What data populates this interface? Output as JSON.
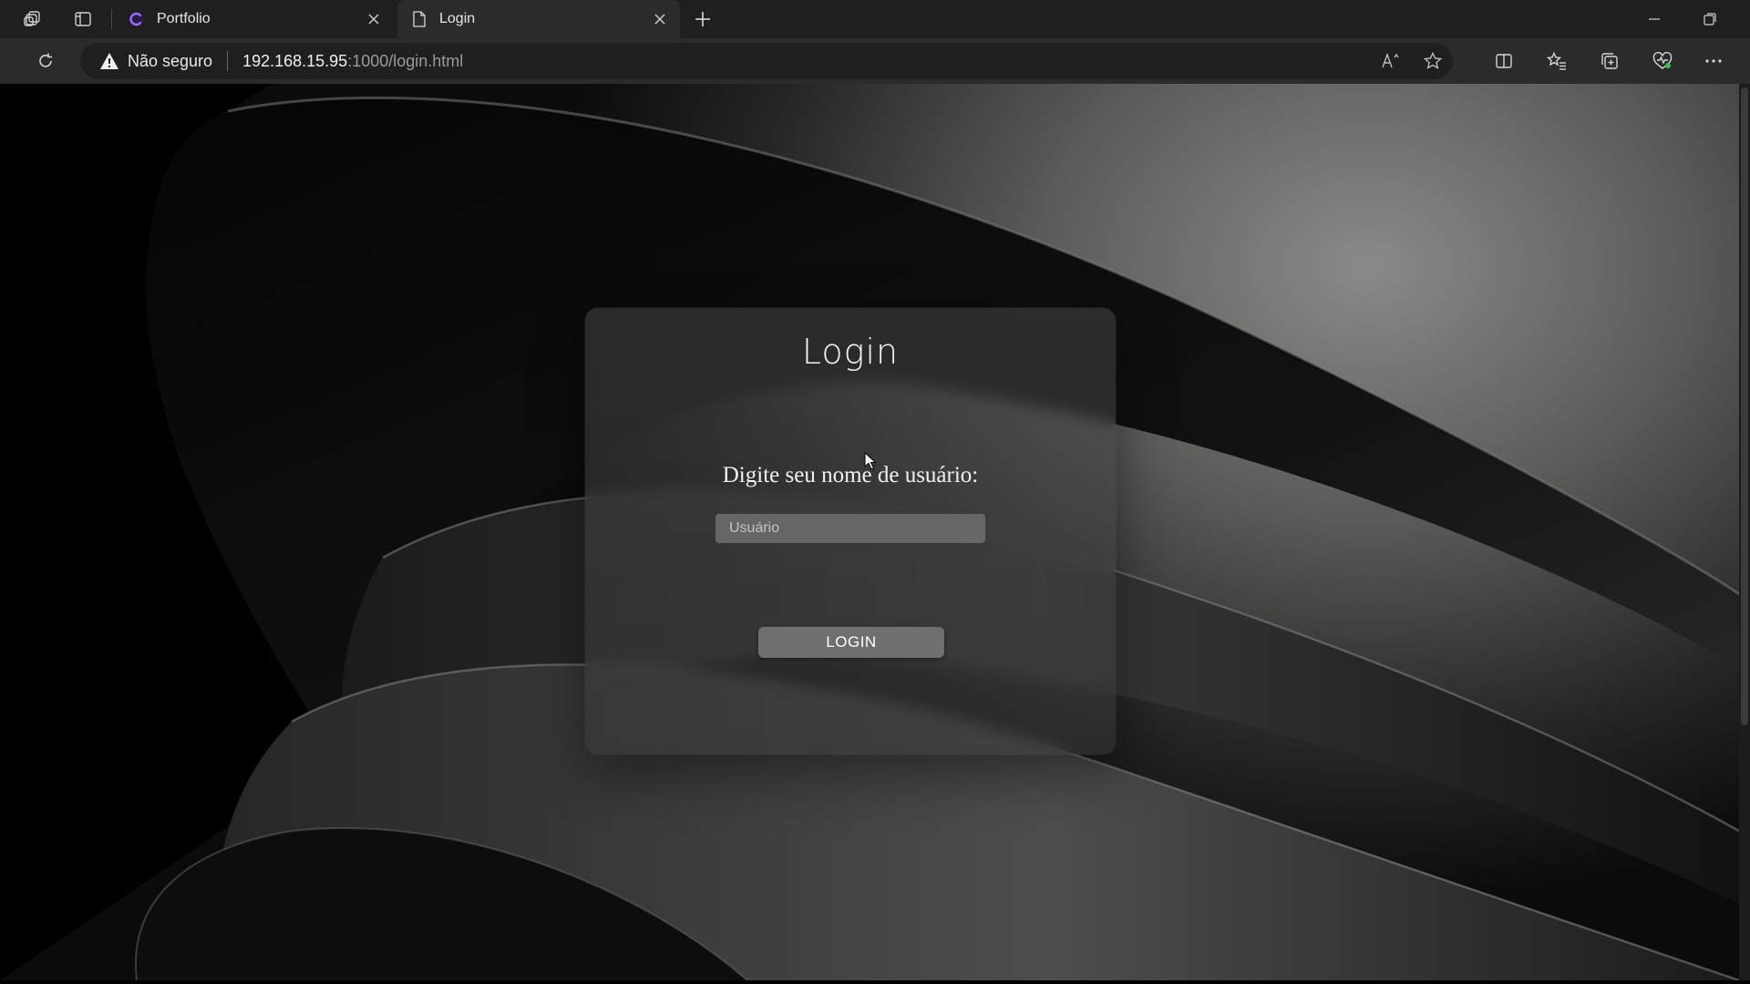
{
  "tabs": [
    {
      "title": "Portfolio",
      "active": false,
      "favicon": "portfolio-logo-icon"
    },
    {
      "title": "Login",
      "active": true,
      "favicon": "page-icon"
    }
  ],
  "address_bar": {
    "security_label": "Não seguro",
    "url_host": "192.168.15.95",
    "url_rest": ":1000/login.html"
  },
  "page": {
    "title": "Login",
    "prompt": "Digite seu nome de usuário:",
    "username_placeholder": "Usuário",
    "username_value": "",
    "login_button": "LOGIN"
  },
  "colors": {
    "tabbar_bg": "#1f1f1f",
    "toolbar_bg": "#2b2b2b",
    "card_bg": "rgba(60,60,60,0.55)",
    "button_bg": "#6f6f6f",
    "favicon_accent": "#8a5cf6"
  }
}
